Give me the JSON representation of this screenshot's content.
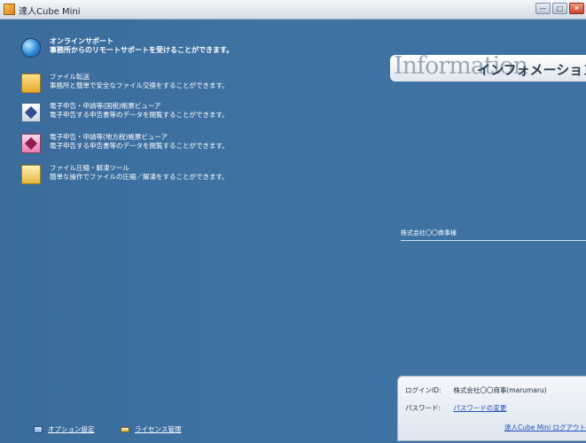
{
  "window": {
    "title": "達人Cube Mini",
    "buttons": {
      "minimize": "—",
      "maximize": "□",
      "close": "✕"
    }
  },
  "menu": [
    {
      "title": "オンラインサポート",
      "desc": "事務所からのリモートサポートを受けることができます。",
      "icon": "globe-icon"
    },
    {
      "title": "ファイル転送",
      "desc": "事務所と簡単で安全なファイル交換をすることができます。",
      "icon": "folder-icon"
    },
    {
      "title": "電子申告・申請等(国税)帳票ビューア",
      "desc": "電子申告する申告書等のデータを閲覧することができます。",
      "icon": "viewer-icon"
    },
    {
      "title": "電子申告・申請等(地方税)帳票ビューア",
      "desc": "電子申告する申告書等のデータを閲覧することができます。",
      "icon": "viewer-icon"
    },
    {
      "title": "ファイル圧縮・解凍ツール",
      "desc": "簡単な操作でファイルの圧縮／解凍をすることができます。",
      "icon": "zip-icon"
    }
  ],
  "info": {
    "english": "Information",
    "japanese": "インフォメーション",
    "company": "株式会社〇〇商事様"
  },
  "login": {
    "id_label": "ログインID:",
    "id_value": "株式会社〇〇商事(marumaru)",
    "pw_label": "パスワード:",
    "pw_link": "パスワードの変更",
    "logout_link": "達人Cube Mini ログアウト"
  },
  "bottom": {
    "options": "オプション設定",
    "license": "ライセンス管理"
  }
}
